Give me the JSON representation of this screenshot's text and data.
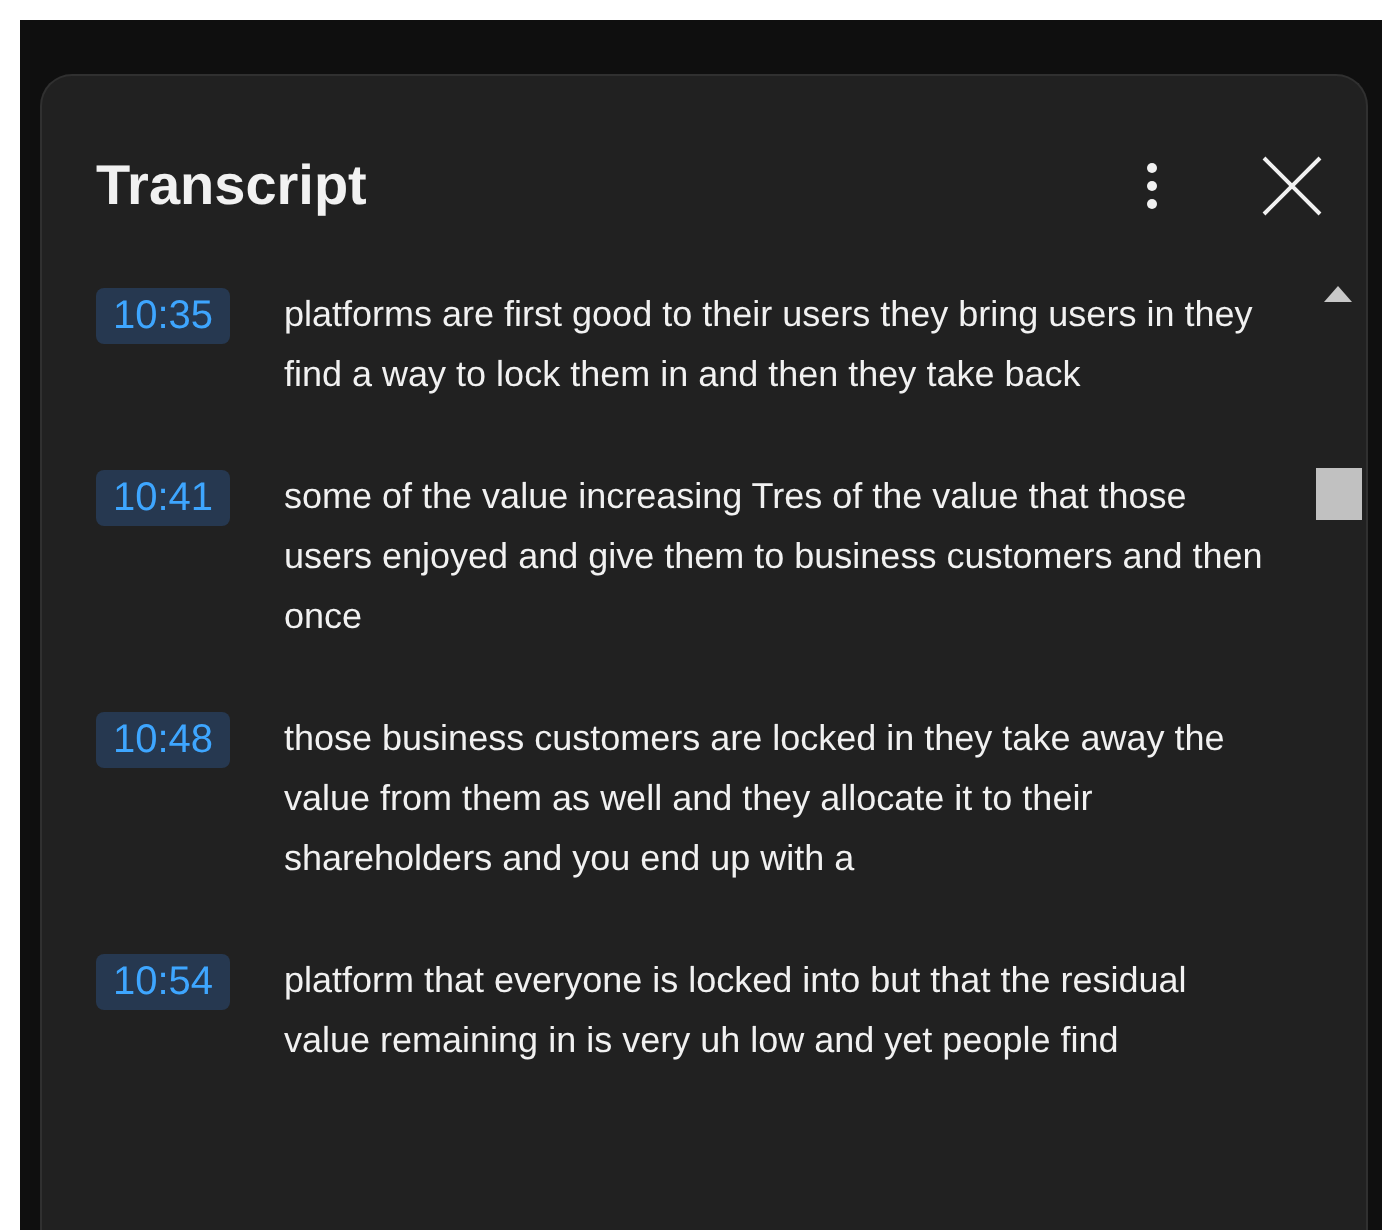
{
  "panel": {
    "title": "Transcript"
  },
  "segments": [
    {
      "time": "10:35",
      "text": "platforms are first good to their users they bring users in they find a way to lock them in and then they take back"
    },
    {
      "time": "10:41",
      "text": "some of the value increasing Tres of the value that those users enjoyed and give them to business customers and then once"
    },
    {
      "time": "10:48",
      "text": "those business customers are locked in they take away the value from them as well and they allocate it to their shareholders and you end up with a"
    },
    {
      "time": "10:54",
      "text": "platform that everyone is locked into but that the residual value remaining in is very uh low and yet people find"
    }
  ]
}
